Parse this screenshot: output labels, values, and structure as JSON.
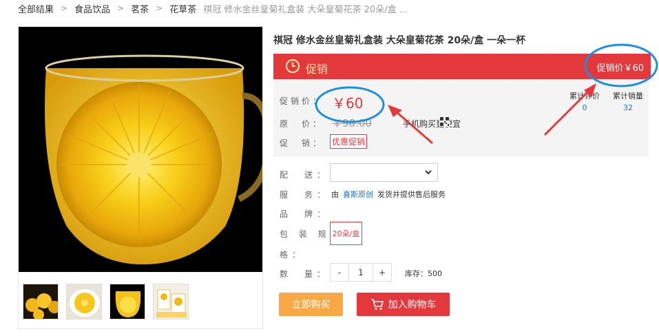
{
  "breadcrumb": [
    "全部结果",
    "食品饮品",
    "茗茶",
    "花草茶",
    "祺冠 修水金丝皇菊礼盒装 大朵皇菊花茶 20朵/盒 ..."
  ],
  "product": {
    "title": "祺冠 修水金丝皇菊礼盒装 大朵皇菊花茶 20朵/盒 一朵一杯"
  },
  "promo_bar": {
    "label": "促销",
    "right_text": "促销价￥60"
  },
  "price_box": {
    "promo_price_label": "促销价：",
    "promo_price": "￥60",
    "orig_price_label": "原　价：",
    "orig_price": "￥98.00",
    "mobile_text": "手机购买更便宜",
    "promo_label": "促　销：",
    "promo_tag": "优惠促销",
    "stats": [
      {
        "label": "累计评价",
        "value": "0"
      },
      {
        "label": "累计销量",
        "value": "32"
      }
    ]
  },
  "options": {
    "delivery_label": "配　送：",
    "delivery_value": "",
    "service_label": "服　务：",
    "service_prefix": "由",
    "service_brand": "喜斯原创",
    "service_suffix": "发货并提供售后服务",
    "brand_label": "品　牌：",
    "spec_label_1": "包 装 规",
    "spec_label_2": "格：",
    "spec_value": "20朵/盒",
    "qty_label": "数　量：",
    "qty_minus": "-",
    "qty_value": "1",
    "qty_plus": "+",
    "stock": "库存：500"
  },
  "actions": {
    "buy_now": "立即购买",
    "add_cart": "加入购物车"
  },
  "colors": {
    "accent_red": "#e4393c",
    "buy_orange": "#f8a945",
    "annotation_blue": "#1a8fe0",
    "link_blue": "#1b73c7"
  }
}
